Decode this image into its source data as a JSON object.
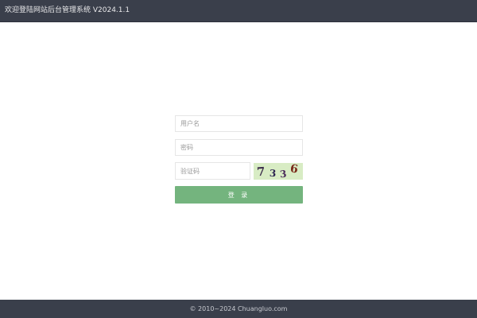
{
  "header": {
    "title": "欢迎登陆网站后台管理系统 V2024.1.1"
  },
  "login": {
    "username_placeholder": "用户名",
    "password_placeholder": "密码",
    "captcha_placeholder": "验证码",
    "captcha_chars": [
      "7",
      "3",
      "3",
      "6"
    ],
    "captcha_colors": [
      "#3b2d4a",
      "#2c2450",
      "#4a2a5a",
      "#7a2a1a"
    ],
    "captcha_background": "#d8ecc4",
    "submit_label": "登 录",
    "submit_color": "#74b47e"
  },
  "footer": {
    "copyright": "© 2010~2024 Chuangluo.com"
  }
}
